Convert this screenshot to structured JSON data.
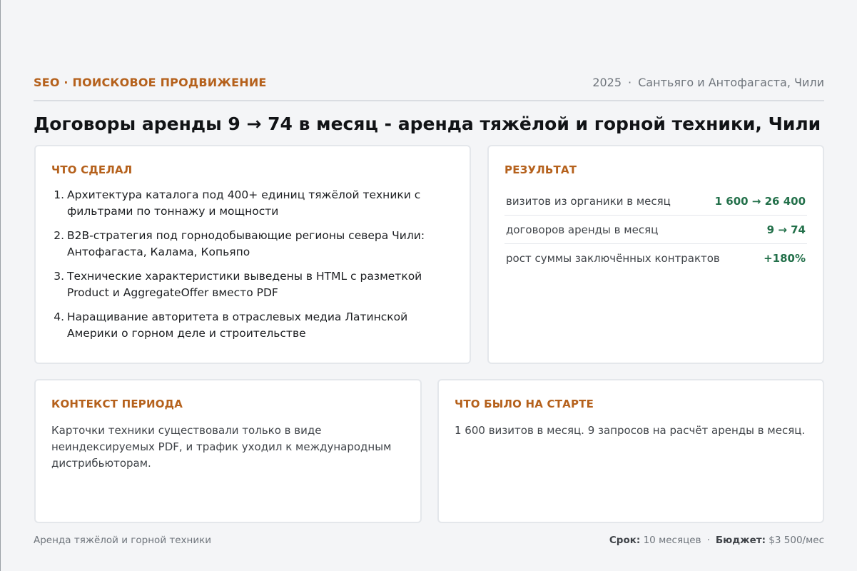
{
  "header": {
    "eyebrow": "SEO · ПОИСКОВОЕ ПРОДВИЖЕНИЕ",
    "year": "2025",
    "separator": "·",
    "location": "Сантьяго и Антофагаста, Чили"
  },
  "title": "Договоры аренды 9 → 74 в месяц - аренда тяжёлой и горной техники, Чили",
  "done": {
    "label": "ЧТО СДЕЛАЛ",
    "items": [
      {
        "num": "1.",
        "text": "Архитектура каталога под 400+ единиц тяжёлой техники с фильтрами по тоннажу и мощности"
      },
      {
        "num": "2.",
        "text": "B2B-стратегия под горнодобывающие регионы севера Чили: Антофагаста, Калама, Копьяпо"
      },
      {
        "num": "3.",
        "text": "Технические характеристики выведены в HTML с разметкой Product и AggregateOffer вместо PDF"
      },
      {
        "num": "4.",
        "text": "Наращивание авторитета в отраслевых медиа Латинской Америки о горном деле и строительстве"
      }
    ]
  },
  "result": {
    "label": "РЕЗУЛЬТАТ",
    "metrics": [
      {
        "label": "визитов из органики в месяц",
        "value": "1 600 → 26 400"
      },
      {
        "label": "договоров аренды в месяц",
        "value": "9 → 74"
      },
      {
        "label": "рост суммы заключённых контрактов",
        "value": "+180%"
      }
    ]
  },
  "context": {
    "label": "КОНТЕКСТ ПЕРИОДА",
    "text": "Карточки техники существовали только в виде неиндексируемых PDF, и трафик уходил к международным дистрибьюторам."
  },
  "start": {
    "label": "ЧТО БЫЛО НА СТАРТЕ",
    "text": "1 600 визитов в месяц. 9 запросов на расчёт аренды в месяц."
  },
  "footer": {
    "industry": "Аренда тяжёлой и горной техники",
    "term_label": "Срок:",
    "term_value": "10 месяцев",
    "separator": "·",
    "budget_label": "Бюджет:",
    "budget_value": "$3 500/мес"
  }
}
